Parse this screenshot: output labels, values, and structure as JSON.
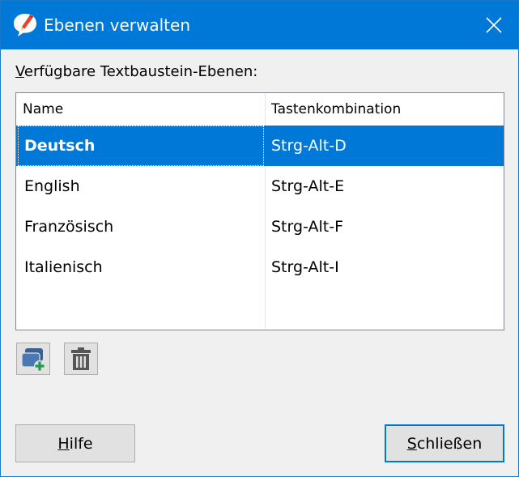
{
  "window": {
    "title": "Ebenen verwalten"
  },
  "list": {
    "label_accel": "V",
    "label_rest": "erfügbare Textbaustein-Ebenen:",
    "columns": [
      "Name",
      "Tastenkombination"
    ],
    "rows": [
      {
        "name": "Deutsch",
        "shortcut": "Strg-Alt-D",
        "selected": true
      },
      {
        "name": "English",
        "shortcut": "Strg-Alt-E",
        "selected": false
      },
      {
        "name": "Französisch",
        "shortcut": "Strg-Alt-F",
        "selected": false
      },
      {
        "name": "Italienisch",
        "shortcut": "Strg-Alt-I",
        "selected": false
      }
    ]
  },
  "buttons": {
    "help_accel": "H",
    "help_rest": "ilfe",
    "close_accel": "S",
    "close_rest": "chließen"
  },
  "icons": {
    "app": "speech-bubble-pencil-icon",
    "close": "close-icon",
    "add_layer": "add-layer-icon",
    "delete": "trash-icon"
  },
  "colors": {
    "accent": "#0078d7",
    "dialog_bg": "#f0f0f0",
    "button_bg": "#e1e1e1"
  }
}
